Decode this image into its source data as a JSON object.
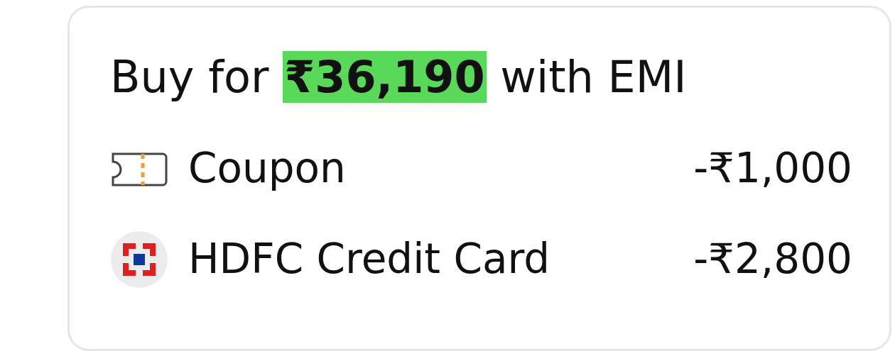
{
  "offer": {
    "title": "Buy for **₹36,190** with EMI",
    "discounts": [
      {
        "kind": "coupon",
        "label": "Coupon",
        "amount": "-₹1,000"
      },
      {
        "kind": "bank",
        "label": "HDFC Credit Card",
        "amount": "-₹2,800"
      }
    ]
  }
}
